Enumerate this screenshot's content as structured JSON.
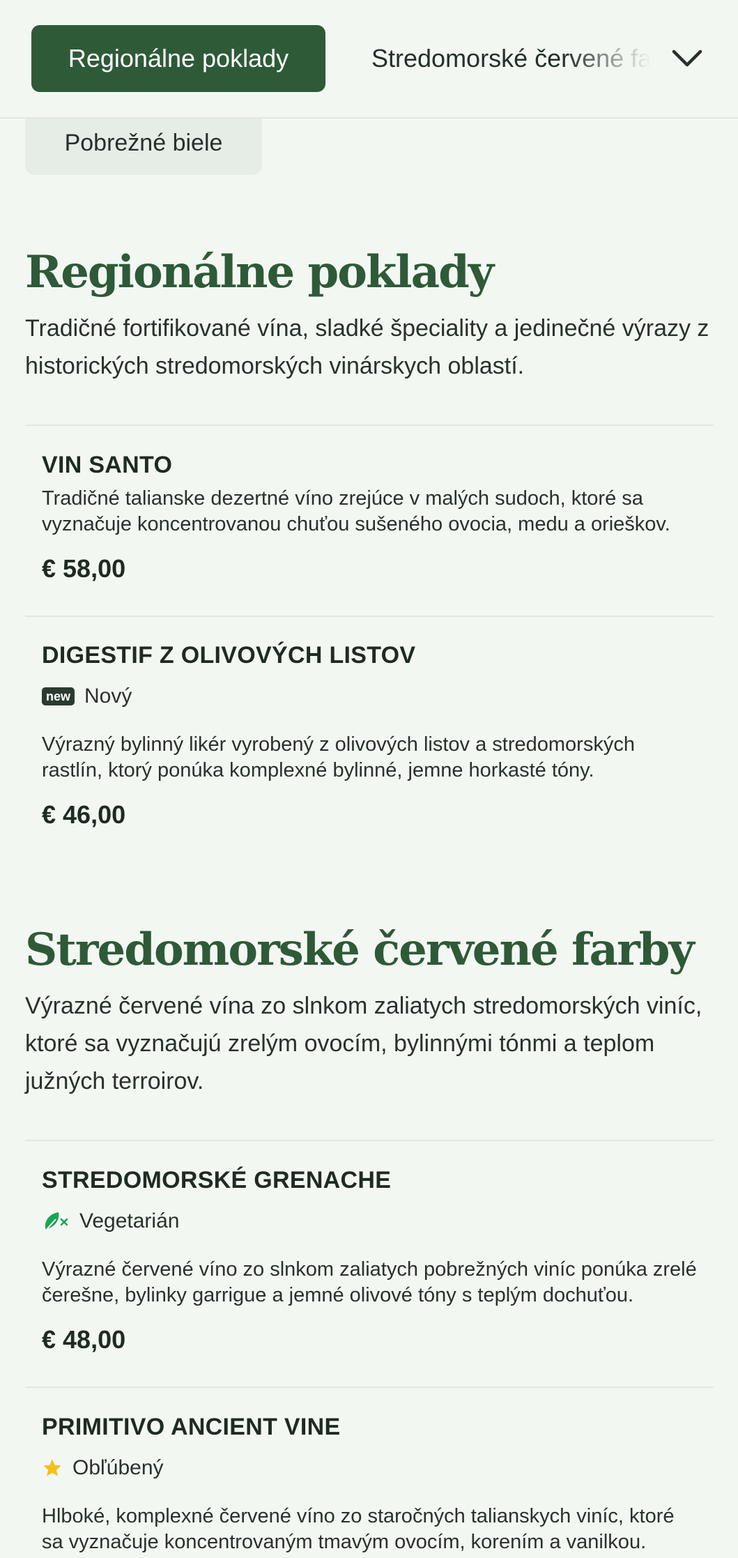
{
  "category_nav": {
    "active_tab": "Regionálne poklady",
    "next_tab": "Stredomorské červené farby",
    "previous_tab": "Pobrežné biele",
    "chevron_icon": "chevron-down-icon"
  },
  "sections": [
    {
      "title": "Regionálne poklady",
      "description": "Tradičné fortifikované vína, sladké špeciality a jedinečné výrazy z historických stredomorských vinárskych oblastí.",
      "items": [
        {
          "name": "VIN SANTO",
          "description": "Tradičné talianske dezertné víno zrejúce v malých sudoch, ktoré sa vyznačuje koncentrovanou chuťou sušeného ovocia, medu a orieškov.",
          "price": "€ 58,00"
        },
        {
          "name": "DIGESTIF Z OLIVOVÝCH LISTOV",
          "badge_tag": "new",
          "badge_label": "Nový",
          "description": "Výrazný bylinný likér vyrobený z olivových listov a stredomorských rastlín, ktorý ponúka komplexné bylinné, jemne horkasté tóny.",
          "price": "€ 46,00"
        }
      ]
    },
    {
      "title": "Stredomorské červené farby",
      "description": "Výrazné červené vína zo slnkom zaliatych stredomorských viníc, ktoré sa vyznačujú zrelým ovocím, bylinnými tónmi a teplom južných terroirov.",
      "items": [
        {
          "name": "STREDOMORSKÉ GRENACHE",
          "badge_icon": "leaf-icon",
          "badge_label": "Vegetarián",
          "description": "Výrazné červené víno zo slnkom zaliatych pobrežných viníc ponúka zrelé čerešne, bylinky garrigue a jemné olivové tóny s teplým dochuťou.",
          "price": "€ 48,00"
        },
        {
          "name": "PRIMITIVO ANCIENT VINE",
          "badge_icon": "star-icon",
          "badge_label": "Obľúbený",
          "description": "Hlboké, komplexné červené víno zo staročných talianskych viníc, ktoré sa vyznačuje koncentrovaným tmavým ovocím, korením a vanilkou."
        }
      ]
    }
  ],
  "colors": {
    "accent": "#2e5a38",
    "background": "#f3f7f2",
    "vegetarian_icon": "#1aa556",
    "favorite_icon": "#f4bf1a"
  }
}
